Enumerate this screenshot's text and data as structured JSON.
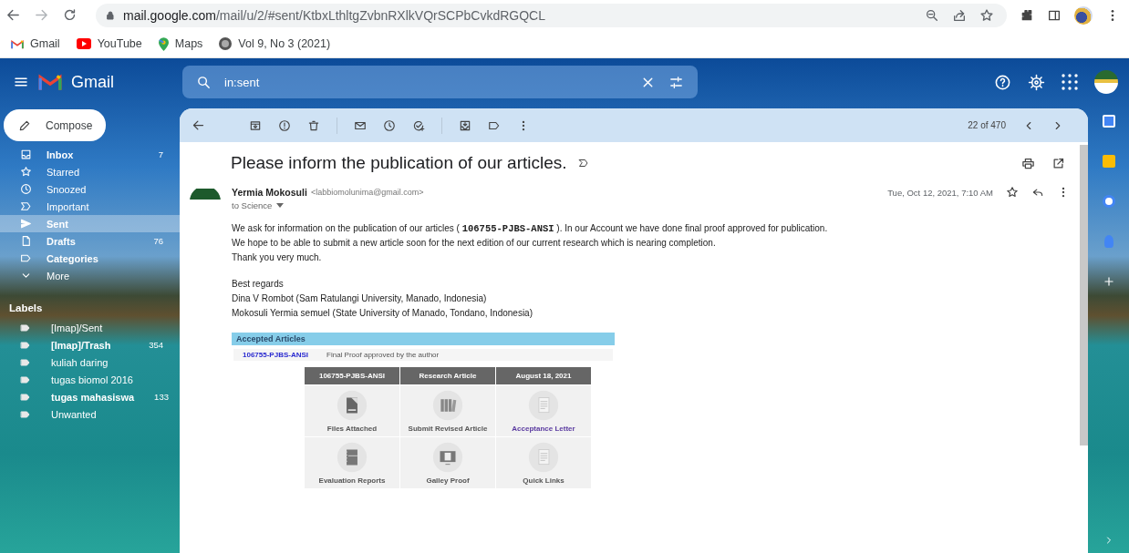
{
  "browser": {
    "host": "mail.google.com",
    "path": "/mail/u/2/#sent/KtbxLthltgZvbnRXlkVQrSCPbCvkdRGQCL",
    "bookmarks": [
      {
        "label": "Gmail",
        "kind": "gmail"
      },
      {
        "label": "YouTube",
        "kind": "youtube"
      },
      {
        "label": "Maps",
        "kind": "maps"
      },
      {
        "label": "Vol 9, No 3 (2021)",
        "kind": "site"
      }
    ]
  },
  "header": {
    "brand": "Gmail",
    "search": {
      "value": "in:sent"
    }
  },
  "sidebar": {
    "compose": "Compose",
    "nav": [
      {
        "label": "Inbox",
        "count": "7",
        "bold": true,
        "selected": false
      },
      {
        "label": "Starred",
        "bold": false,
        "selected": false
      },
      {
        "label": "Snoozed",
        "bold": false,
        "selected": false
      },
      {
        "label": "Important",
        "bold": false,
        "selected": false
      },
      {
        "label": "Sent",
        "bold": true,
        "selected": true
      },
      {
        "label": "Drafts",
        "count": "76",
        "bold": true,
        "selected": false
      },
      {
        "label": "Categories",
        "bold": true,
        "selected": false
      },
      {
        "label": "More",
        "bold": false,
        "selected": false
      }
    ],
    "labels_heading": "Labels",
    "labels": [
      {
        "label": "[Imap]/Sent",
        "bold": false
      },
      {
        "label": "[Imap]/Trash",
        "count": "354",
        "bold": true
      },
      {
        "label": "kuliah daring",
        "bold": false
      },
      {
        "label": "tugas biomol 2016",
        "bold": false
      },
      {
        "label": "tugas mahasiswa",
        "count": "133",
        "bold": true
      },
      {
        "label": "Unwanted",
        "bold": false
      }
    ]
  },
  "email": {
    "pager": "22 of 470",
    "subject": "Please inform the publication of our articles.",
    "sender_name": "Yermia Mokosuli",
    "sender_email": "<labbiomolunima@gmail.com>",
    "recipient": "to Science",
    "date": "Tue, Oct 12, 2021, 7:10 AM",
    "paragraphs": [
      [
        "We ask for information on the publication of our articles ( **106755-PJBS-ANSI** ). In our Account we have done final proof approved for publication.",
        "We hope to be able to submit a new article soon for the next edition of our current research which is nearing completion.",
        "Thank you very much."
      ],
      [
        "Best regards",
        "Dina V Rombot (Sam Ratulangi University, Manado, Indonesia)",
        "Mokosuli Yermia semuel (State University of Manado, Tondano, Indonesia)"
      ]
    ],
    "attachment": {
      "title": "Accepted Articles",
      "code": "106755-PJBS-ANSI",
      "status": "Final Proof approved by the author",
      "headers": [
        "106755-PJBS-ANSI",
        "Research Article",
        "August 18, 2021"
      ],
      "tiles": [
        {
          "label": "Files Attached",
          "link": false
        },
        {
          "label": "Submit Revised Article",
          "link": false
        },
        {
          "label": "Acceptance Letter",
          "link": true
        },
        {
          "label": "Evaluation Reports",
          "link": false
        },
        {
          "label": "Galley Proof",
          "link": false
        },
        {
          "label": "Quick Links",
          "link": false
        }
      ]
    }
  }
}
